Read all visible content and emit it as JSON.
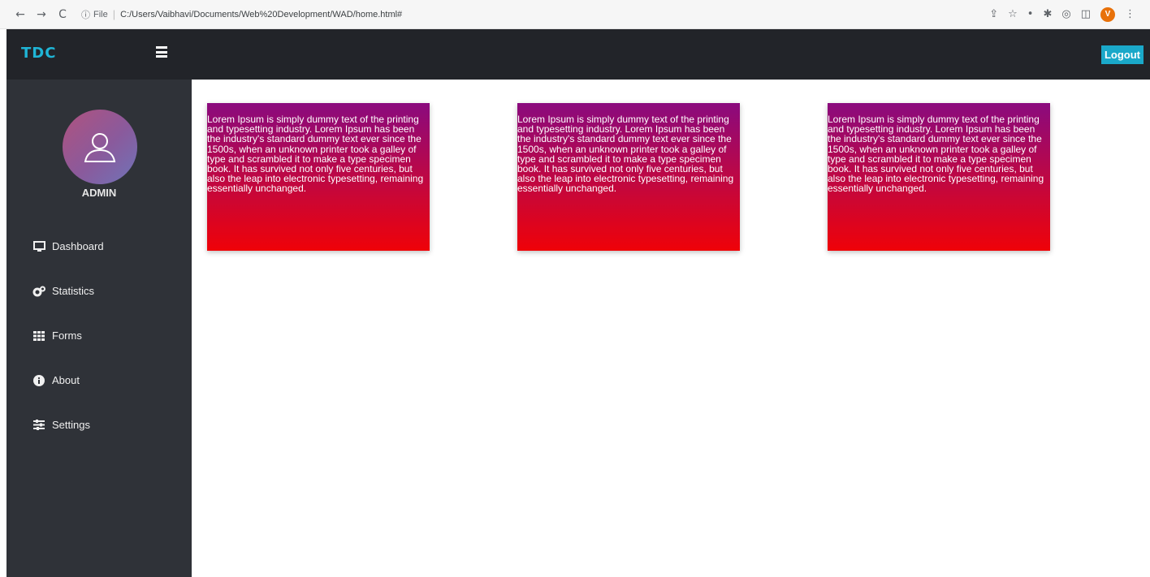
{
  "browser": {
    "back": "←",
    "forward": "→",
    "reload": "C",
    "info": "ⓘ",
    "scheme": "File",
    "url": "C:/Users/Vaibhavi/Documents/Web%20Development/WAD/home.html#",
    "profile_initial": "V",
    "icons": [
      "share-icon",
      "star-icon",
      "extension-icon",
      "puzzle-icon",
      "sidebar-icon",
      "profile-icon",
      "more-icon"
    ]
  },
  "header": {
    "brand": "TDC",
    "logout_label": "Logout"
  },
  "sidebar": {
    "user_label": "ADMIN",
    "items": [
      {
        "label": "Dashboard",
        "icon": "desktop-icon"
      },
      {
        "label": "Statistics",
        "icon": "cogs-icon"
      },
      {
        "label": "Forms",
        "icon": "table-icon"
      },
      {
        "label": "About",
        "icon": "info-circle-icon"
      },
      {
        "label": "Settings",
        "icon": "sliders-icon"
      }
    ]
  },
  "cards": [
    {
      "text": "Lorem Ipsum is simply dummy text of the printing and typesetting industry. Lorem Ipsum has been the industry's standard dummy text ever since the 1500s, when an unknown printer took a galley of type and scrambled it to make a type specimen book. It has survived not only five centuries, but also the leap into electronic typesetting, remaining essentially unchanged."
    },
    {
      "text": "Lorem Ipsum is simply dummy text of the printing and typesetting industry. Lorem Ipsum has been the industry's standard dummy text ever since the 1500s, when an unknown printer took a galley of type and scrambled it to make a type specimen book. It has survived not only five centuries, but also the leap into electronic typesetting, remaining essentially unchanged."
    },
    {
      "text": "Lorem Ipsum is simply dummy text of the printing and typesetting industry. Lorem Ipsum has been the industry's standard dummy text ever since the 1500s, when an unknown printer took a galley of type and scrambled it to make a type specimen book. It has survived not only five centuries, but also the leap into electronic typesetting, remaining essentially unchanged."
    }
  ],
  "colors": {
    "topbar": "#222429",
    "sidebar": "#2f3238",
    "brand": "#1fb5d6",
    "logout": "#1aa8c9",
    "card_top": "#8a0a7e",
    "card_bottom": "#ef0208"
  }
}
